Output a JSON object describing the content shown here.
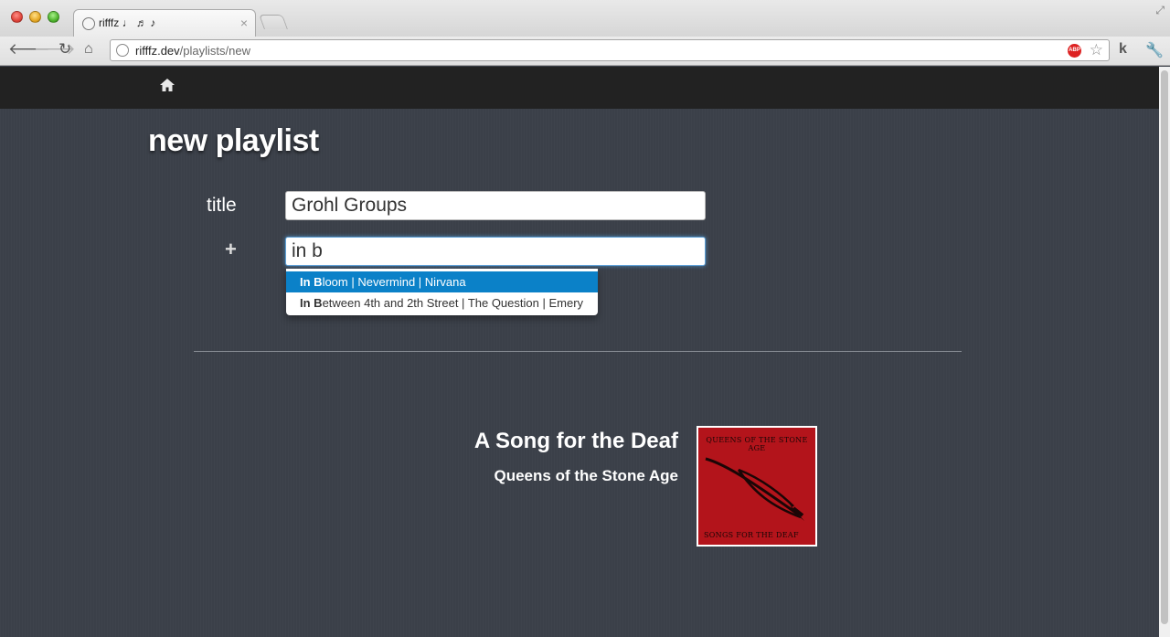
{
  "browser": {
    "tab_title": "rifffz ♩ ♬ ♪",
    "tab_close": "×",
    "url_host": "rifffz.dev",
    "url_path": "/playlists/new",
    "abp_label": "ABP",
    "ext_k_label": "k"
  },
  "page": {
    "title": "new playlist",
    "form": {
      "title_label": "title",
      "title_value": "Grohl Groups",
      "add_symbol": "+",
      "song_query": "in b"
    },
    "suggestions": [
      {
        "match": "In B",
        "rest": "loom | Nevermind | Nirvana",
        "active": true
      },
      {
        "match": "In B",
        "rest": "etween 4th and 2th Street | The Question | Emery",
        "active": false
      }
    ],
    "album": {
      "title": "A Song for the Deaf",
      "artist": "Queens of the Stone Age",
      "cover_top_text": "QUEENS OF THE STONE AGE",
      "cover_bottom_text": "SONGS FOR THE DEAF",
      "cover_color": "#b3141b"
    }
  },
  "colors": {
    "page_bg": "#3b4049",
    "navbar_bg": "#222222",
    "highlight": "#0b81c8"
  }
}
